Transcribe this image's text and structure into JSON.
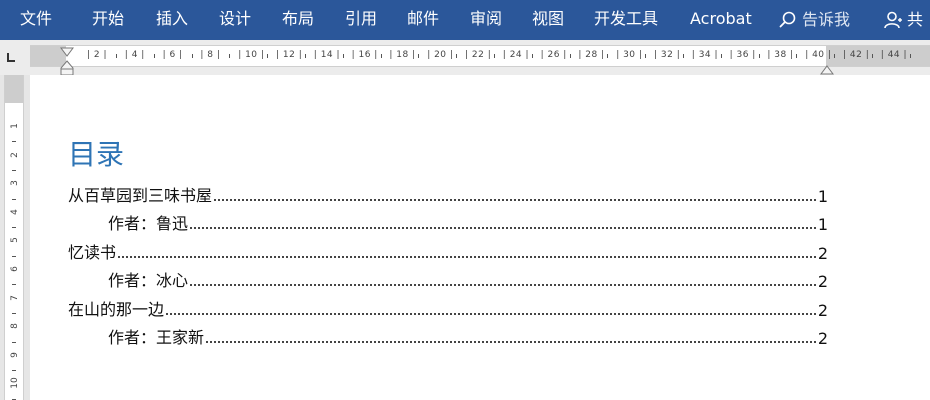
{
  "ribbon": {
    "tabs": [
      {
        "label": "文件"
      },
      {
        "label": "开始"
      },
      {
        "label": "插入"
      },
      {
        "label": "设计"
      },
      {
        "label": "布局"
      },
      {
        "label": "引用"
      },
      {
        "label": "邮件"
      },
      {
        "label": "审阅"
      },
      {
        "label": "视图"
      },
      {
        "label": "开发工具"
      },
      {
        "label": "Acrobat"
      }
    ],
    "search_label": "告诉我",
    "share_label": "共",
    "colors": {
      "background": "#2b579a",
      "text": "#ffffff"
    }
  },
  "ruler": {
    "horizontal_numbers": [
      "2",
      "4",
      "6",
      "8",
      "10",
      "12",
      "14",
      "16",
      "18",
      "20",
      "22",
      "24",
      "26",
      "28",
      "30",
      "32",
      "34",
      "36",
      "38",
      "40",
      "42",
      "44"
    ],
    "vertical_numbers": [
      "1",
      "2",
      "3",
      "4",
      "5",
      "6",
      "7",
      "8",
      "9",
      "10"
    ]
  },
  "document": {
    "toc_title": "目录",
    "title_color": "#2e74b5",
    "entries": [
      {
        "text": "从百草园到三味书屋",
        "page": "1",
        "level": 1
      },
      {
        "text": "作者：鲁迅",
        "page": "1",
        "level": 2
      },
      {
        "text": "忆读书",
        "page": "2",
        "level": 1
      },
      {
        "text": "作者：冰心",
        "page": "2",
        "level": 2
      },
      {
        "text": "在山的那一边",
        "page": "2",
        "level": 1
      },
      {
        "text": "作者：王家新",
        "page": "2",
        "level": 2
      }
    ]
  }
}
